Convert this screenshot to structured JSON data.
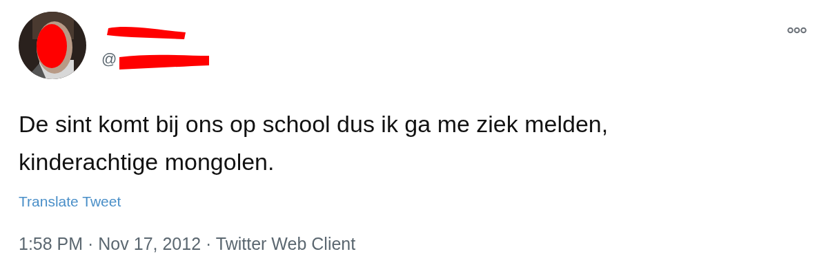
{
  "author": {
    "handle": "@",
    "redacted": true
  },
  "tweet": {
    "text": "De sint komt bij ons op school dus ik ga me ziek melden, kinderachtige mongolen.",
    "translate_link": "Translate Tweet"
  },
  "meta": "1:58 PM · Nov 17, 2012 · Twitter Web Client"
}
